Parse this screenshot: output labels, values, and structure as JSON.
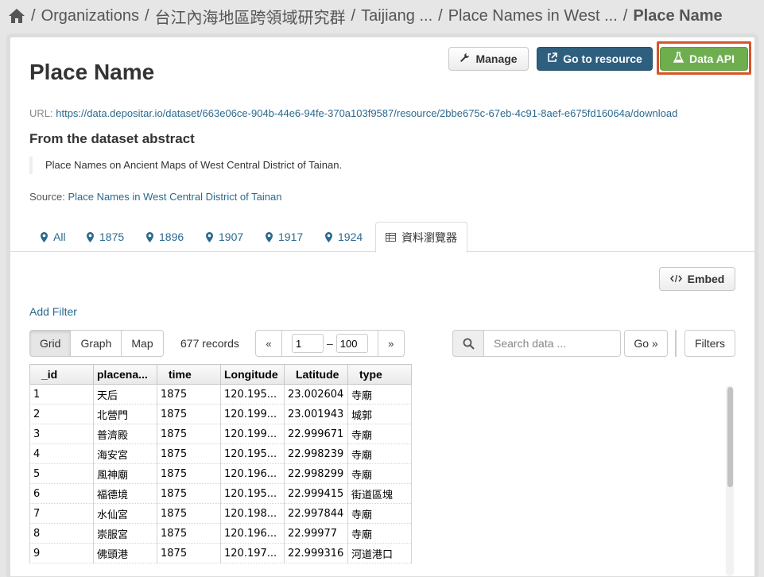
{
  "breadcrumb": {
    "items": [
      "Organizations",
      "台江內海地區跨領域研究群",
      "Taijiang ...",
      "Place Names in West ..."
    ],
    "current": "Place Name",
    "separator": "/"
  },
  "page": {
    "title": "Place Name",
    "url_label": "URL:",
    "url": "https://data.depositar.io/dataset/663e06ce-904b-44e6-94fe-370a103f9587/resource/2bbe675c-67eb-4c91-8aef-e675fd16064a/download",
    "abstract_heading": "From the dataset abstract",
    "abstract_text": "Place Names on Ancient Maps of West Central District of Tainan.",
    "source_label": "Source:",
    "source_link": "Place Names in West Central District of Tainan"
  },
  "actions": {
    "manage": "Manage",
    "go_to_resource": "Go to resource",
    "data_api": "Data API",
    "embed": "Embed"
  },
  "tabs": [
    "All",
    "1875",
    "1896",
    "1907",
    "1917",
    "1924",
    "資料瀏覽器"
  ],
  "explorer": {
    "add_filter": "Add Filter",
    "views": [
      "Grid",
      "Graph",
      "Map"
    ],
    "records": "677 records",
    "pager_prev": "«",
    "pager_next": "»",
    "pager_from": "1",
    "pager_to": "100",
    "pager_dash": "–",
    "search_placeholder": "Search data ...",
    "go": "Go »",
    "filters": "Filters"
  },
  "grid": {
    "columns": [
      "_id",
      "placena...",
      "time",
      "Longitude",
      "Latitude",
      "type"
    ],
    "rows": [
      [
        "1",
        "天后",
        "1875",
        "120.195...",
        "23.002604",
        "寺廟"
      ],
      [
        "2",
        "北營門",
        "1875",
        "120.199...",
        "23.001943",
        "城郭"
      ],
      [
        "3",
        "普濟殿",
        "1875",
        "120.199...",
        "22.999671",
        "寺廟"
      ],
      [
        "4",
        "海安宮",
        "1875",
        "120.195...",
        "22.998239",
        "寺廟"
      ],
      [
        "5",
        "風神廟",
        "1875",
        "120.196...",
        "22.998299",
        "寺廟"
      ],
      [
        "6",
        "福德境",
        "1875",
        "120.195...",
        "22.999415",
        "街道區塊"
      ],
      [
        "7",
        "水仙宮",
        "1875",
        "120.198...",
        "22.997844",
        "寺廟"
      ],
      [
        "8",
        "崇服宮",
        "1875",
        "120.196...",
        "22.99977",
        "寺廟"
      ],
      [
        "9",
        "佛頭港",
        "1875",
        "120.197...",
        "22.999316",
        "河道港口"
      ]
    ]
  },
  "colors": {
    "primary": "#2f5f7f",
    "success": "#6fae4f",
    "highlight": "#d6542a",
    "link": "#2b6a8f"
  },
  "icons": {
    "home": "home-icon",
    "manage": "wrench-icon",
    "go_to_resource": "external-link-icon",
    "data_api": "flask-icon",
    "embed": "code-icon",
    "tab": "map-marker-icon",
    "explorer_tab": "table-icon",
    "search": "search-icon"
  }
}
